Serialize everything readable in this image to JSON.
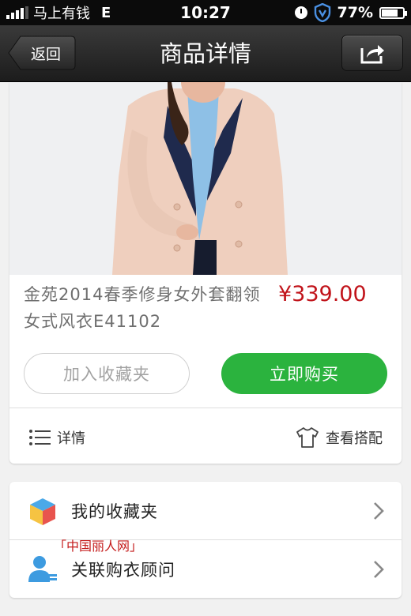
{
  "status_bar": {
    "carrier": "马上有钱",
    "network": "E",
    "time": "10:27",
    "battery": "77%",
    "battery_level": 0.77,
    "icons": [
      "signal-icon",
      "clock-icon",
      "shield-icon",
      "battery-icon"
    ]
  },
  "navbar": {
    "back_label": "返回",
    "title": "商品详情",
    "share_icon": "share-icon"
  },
  "product": {
    "title": "金苑2014春季修身女外套翻领女式风衣E41102",
    "price": "¥339.00",
    "fav_button": "加入收藏夹",
    "buy_button": "立即购买",
    "detail_link": "详情",
    "outfit_link": "查看搭配"
  },
  "list": {
    "items": [
      {
        "label": "我的收藏夹",
        "icon": "favorites-box-icon"
      },
      {
        "label": "关联购衣顾问",
        "icon": "advisor-person-icon"
      }
    ]
  },
  "watermark": "「中国丽人网」",
  "colors": {
    "price_red": "#c1131a",
    "buy_green": "#2bb33e",
    "navbar_dark": "#2a2a2a"
  }
}
